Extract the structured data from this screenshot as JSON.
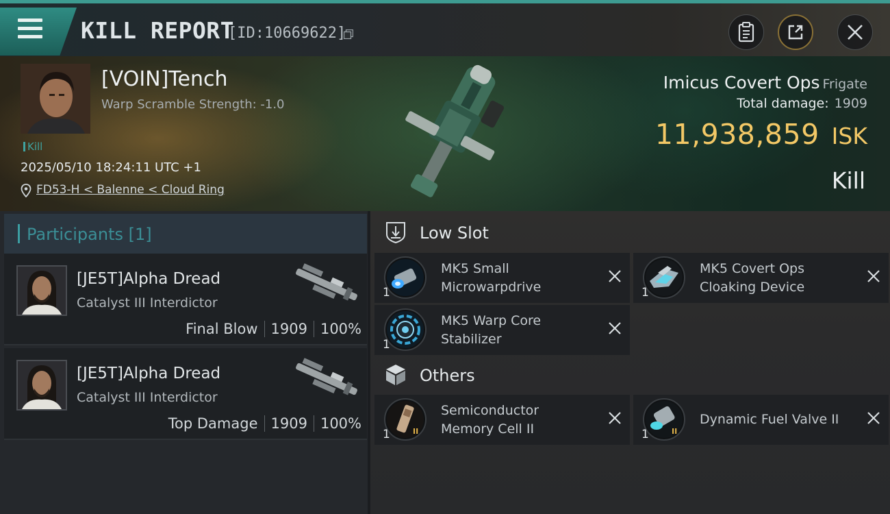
{
  "header": {
    "title": "KILL REPORT",
    "kill_id": "[ID:10669622]"
  },
  "victim": {
    "name": "[VOIN]Tench",
    "warp_scramble": "Warp Scramble Strength: -1.0",
    "kill_tag": "Kill",
    "timestamp": "2025/05/10 18:24:11 UTC +1",
    "location": "FD53-H < Balenne < Cloud Ring"
  },
  "ship": {
    "name": "Imicus Covert Ops",
    "class": "Frigate",
    "total_damage_label": "Total damage:",
    "total_damage": "1909",
    "isk_value": "11,938,859",
    "isk_unit": "ISK",
    "result": "Kill"
  },
  "participants": {
    "title": "Participants [1]",
    "rows": [
      {
        "name": "[JE5T]Alpha Dread",
        "ship": "Catalyst III Interdictor",
        "role": "Final Blow",
        "damage": "1909",
        "percent": "100%"
      },
      {
        "name": "[JE5T]Alpha Dread",
        "ship": "Catalyst III Interdictor",
        "role": "Top Damage",
        "damage": "1909",
        "percent": "100%"
      }
    ]
  },
  "fitting": {
    "low_slot": {
      "title": "Low Slot",
      "modules": [
        {
          "qty": "1",
          "line1": "MK5 Small",
          "line2": "Microwarpdrive",
          "icon": "microwarpdrive-icon"
        },
        {
          "qty": "1",
          "line1": "MK5 Covert Ops",
          "line2": "Cloaking Device",
          "icon": "cloaking-device-icon"
        },
        {
          "qty": "1",
          "line1": "MK5 Warp Core",
          "line2": "Stabilizer",
          "icon": "warp-core-stabilizer-icon"
        }
      ]
    },
    "others": {
      "title": "Others",
      "modules": [
        {
          "qty": "1",
          "line1": "Semiconductor",
          "line2": "Memory Cell II",
          "tier": "II",
          "icon": "memory-cell-icon"
        },
        {
          "qty": "1",
          "line1": "Dynamic Fuel Valve II",
          "line2": "",
          "tier": "II",
          "icon": "fuel-valve-icon"
        }
      ]
    }
  },
  "colors": {
    "accent_teal": "#3d9b91",
    "isk_gold": "#f3c866",
    "share_ring": "#8a7136"
  }
}
